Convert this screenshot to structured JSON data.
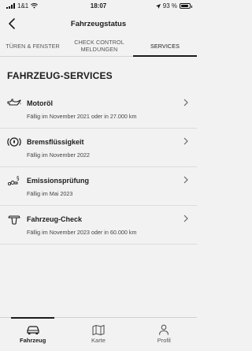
{
  "status_bar": {
    "carrier": "1&1",
    "time": "18:07",
    "battery": "93 %"
  },
  "nav": {
    "title": "Fahrzeugstatus"
  },
  "tabs": [
    {
      "label": "TÜREN & FENSTER",
      "active": false
    },
    {
      "label": "CHECK CONTROL MELDUNGEN",
      "active": false
    },
    {
      "label": "SERVICES",
      "active": true
    }
  ],
  "section": {
    "title": "FAHRZEUG-SERVICES"
  },
  "services": [
    {
      "icon": "oil-can-icon",
      "title": "Motoröl",
      "due": "Fällig im November 2021 oder in 27.000 km"
    },
    {
      "icon": "brake-fluid-icon",
      "title": "Bremsflüssigkeit",
      "due": "Fällig im November 2022"
    },
    {
      "icon": "emission-icon",
      "title": "Emissionsprüfung",
      "due": "Fällig im Mai 2023"
    },
    {
      "icon": "vehicle-check-icon",
      "title": "Fahrzeug-Check",
      "due": "Fällig im November 2023 oder in 60.000 km"
    }
  ],
  "bottom_nav": [
    {
      "icon": "car-icon",
      "label": "Fahrzeug",
      "active": true
    },
    {
      "icon": "map-icon",
      "label": "Karte",
      "active": false
    },
    {
      "icon": "person-icon",
      "label": "Profil",
      "active": false
    }
  ]
}
